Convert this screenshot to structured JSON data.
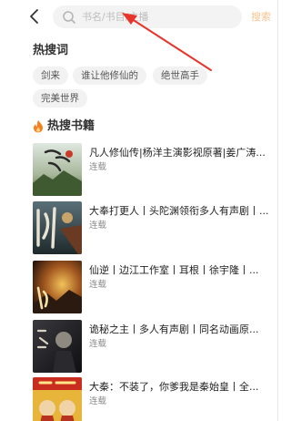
{
  "header": {
    "back_icon": "chevron-left-icon",
    "search_icon": "search-icon",
    "search_placeholder": "书名/书目/主播",
    "search_button": "搜索"
  },
  "hot_words": {
    "title": "热搜词",
    "items": [
      "剑来",
      "谁让他修仙的",
      "绝世高手",
      "完美世界"
    ]
  },
  "hot_books": {
    "icon": "fire-icon",
    "title": "热搜书籍",
    "items": [
      {
        "title": "凡人修仙传|杨洋主演影视原著|姜广涛...",
        "status": "连载"
      },
      {
        "title": "大奉打更人丨头陀渊领衔多人有声剧丨...",
        "status": "连载"
      },
      {
        "title": "仙逆丨边江工作室丨耳根丨徐宇隆丨...",
        "status": "连载"
      },
      {
        "title": "诡秘之主丨多人有声剧丨同名动画原...",
        "status": "连载"
      },
      {
        "title": "大秦：不装了，你爹我是秦始皇丨全...",
        "status": "连载"
      }
    ]
  },
  "colors": {
    "accent": "#f5821f",
    "annotation_arrow": "#e8352b",
    "search_button": "#f6c48f"
  }
}
